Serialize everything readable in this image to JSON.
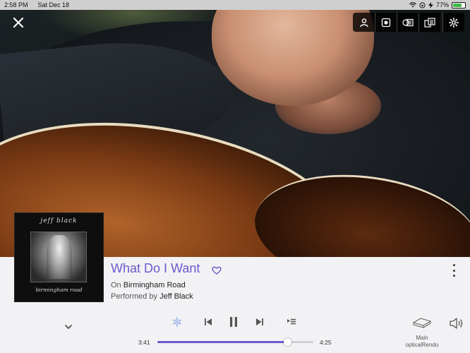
{
  "status_bar": {
    "time": "2:58 PM",
    "date": "Sat Dec 18",
    "battery_percent": "77%",
    "battery_level": 0.77,
    "icons": [
      "wifi-icon",
      "orientation-lock-icon",
      "charging-icon"
    ]
  },
  "overlay": {
    "close_icon": "close-icon",
    "tools": [
      "person-icon",
      "record-icon",
      "lyrics-icon",
      "queue-icon",
      "settings-icon"
    ]
  },
  "album_art": {
    "artist_text": "jeff black",
    "album_text": "birmingham road"
  },
  "track": {
    "title": "What Do I Want",
    "on_prefix": "On",
    "album": "Birmingham Road",
    "performed_prefix": "Performed by",
    "artist": "Jeff Black"
  },
  "playback": {
    "elapsed": "3:41",
    "total": "4:25",
    "progress": 0.836,
    "controls": [
      "radio-icon",
      "previous-icon",
      "pause-icon",
      "next-icon",
      "queue-add-icon"
    ]
  },
  "zone": {
    "label_line1": "Main",
    "label_line2": "opticalRendu"
  },
  "colors": {
    "accent": "#6a5acd",
    "panel_bg": "#f2f2f5"
  }
}
